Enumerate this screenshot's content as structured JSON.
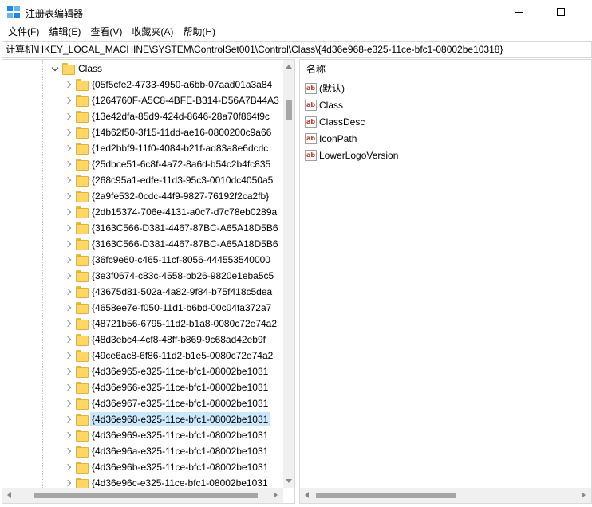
{
  "window": {
    "title": "注册表编辑器",
    "icon": "regedit-icon"
  },
  "menu": [
    "文件(F)",
    "编辑(E)",
    "查看(V)",
    "收藏夹(A)",
    "帮助(H)"
  ],
  "address": "计算机\\HKEY_LOCAL_MACHINE\\SYSTEM\\ControlSet001\\Control\\Class\\{4d36e968-e325-11ce-bfc1-08002be10318}",
  "tree": {
    "parent": "Class",
    "selected_index": 22,
    "items": [
      "{05f5cfe2-4733-4950-a6bb-07aad01a3a84",
      "{1264760F-A5C8-4BFE-B314-D56A7B44A3",
      "{13e42dfa-85d9-424d-8646-28a70f864f9c",
      "{14b62f50-3f15-11dd-ae16-0800200c9a66",
      "{1ed2bbf9-11f0-4084-b21f-ad83a8e6dcdc",
      "{25dbce51-6c8f-4a72-8a6d-b54c2b4fc835",
      "{268c95a1-edfe-11d3-95c3-0010dc4050a5",
      "{2a9fe532-0cdc-44f9-9827-76192f2ca2fb}",
      "{2db15374-706e-4131-a0c7-d7c78eb0289a",
      "{3163C566-D381-4467-87BC-A65A18D5B6",
      "{3163C566-D381-4467-87BC-A65A18D5B6",
      "{36fc9e60-c465-11cf-8056-444553540000",
      "{3e3f0674-c83c-4558-bb26-9820e1eba5c5",
      "{43675d81-502a-4a82-9f84-b75f418c5dea",
      "{4658ee7e-f050-11d1-b6bd-00c04fa372a7",
      "{48721b56-6795-11d2-b1a8-0080c72e74a2",
      "{48d3ebc4-4cf8-48ff-b869-9c68ad42eb9f",
      "{49ce6ac8-6f86-11d2-b1e5-0080c72e74a2",
      "{4d36e965-e325-11ce-bfc1-08002be1031",
      "{4d36e966-e325-11ce-bfc1-08002be1031",
      "{4d36e967-e325-11ce-bfc1-08002be1031",
      "{4d36e968-e325-11ce-bfc1-08002be1031",
      "{4d36e969-e325-11ce-bfc1-08002be1031",
      "{4d36e96a-e325-11ce-bfc1-08002be1031",
      "{4d36e96b-e325-11ce-bfc1-08002be1031",
      "{4d36e96c-e325-11ce-bfc1-08002be1031"
    ]
  },
  "values": {
    "column_name": "名称",
    "icon": "string-value-icon",
    "rows": [
      "(默认)",
      "Class",
      "ClassDesc",
      "IconPath",
      "LowerLogoVersion"
    ]
  },
  "colors": {
    "selection": "#cce8ff",
    "folder": "#ffd766"
  }
}
